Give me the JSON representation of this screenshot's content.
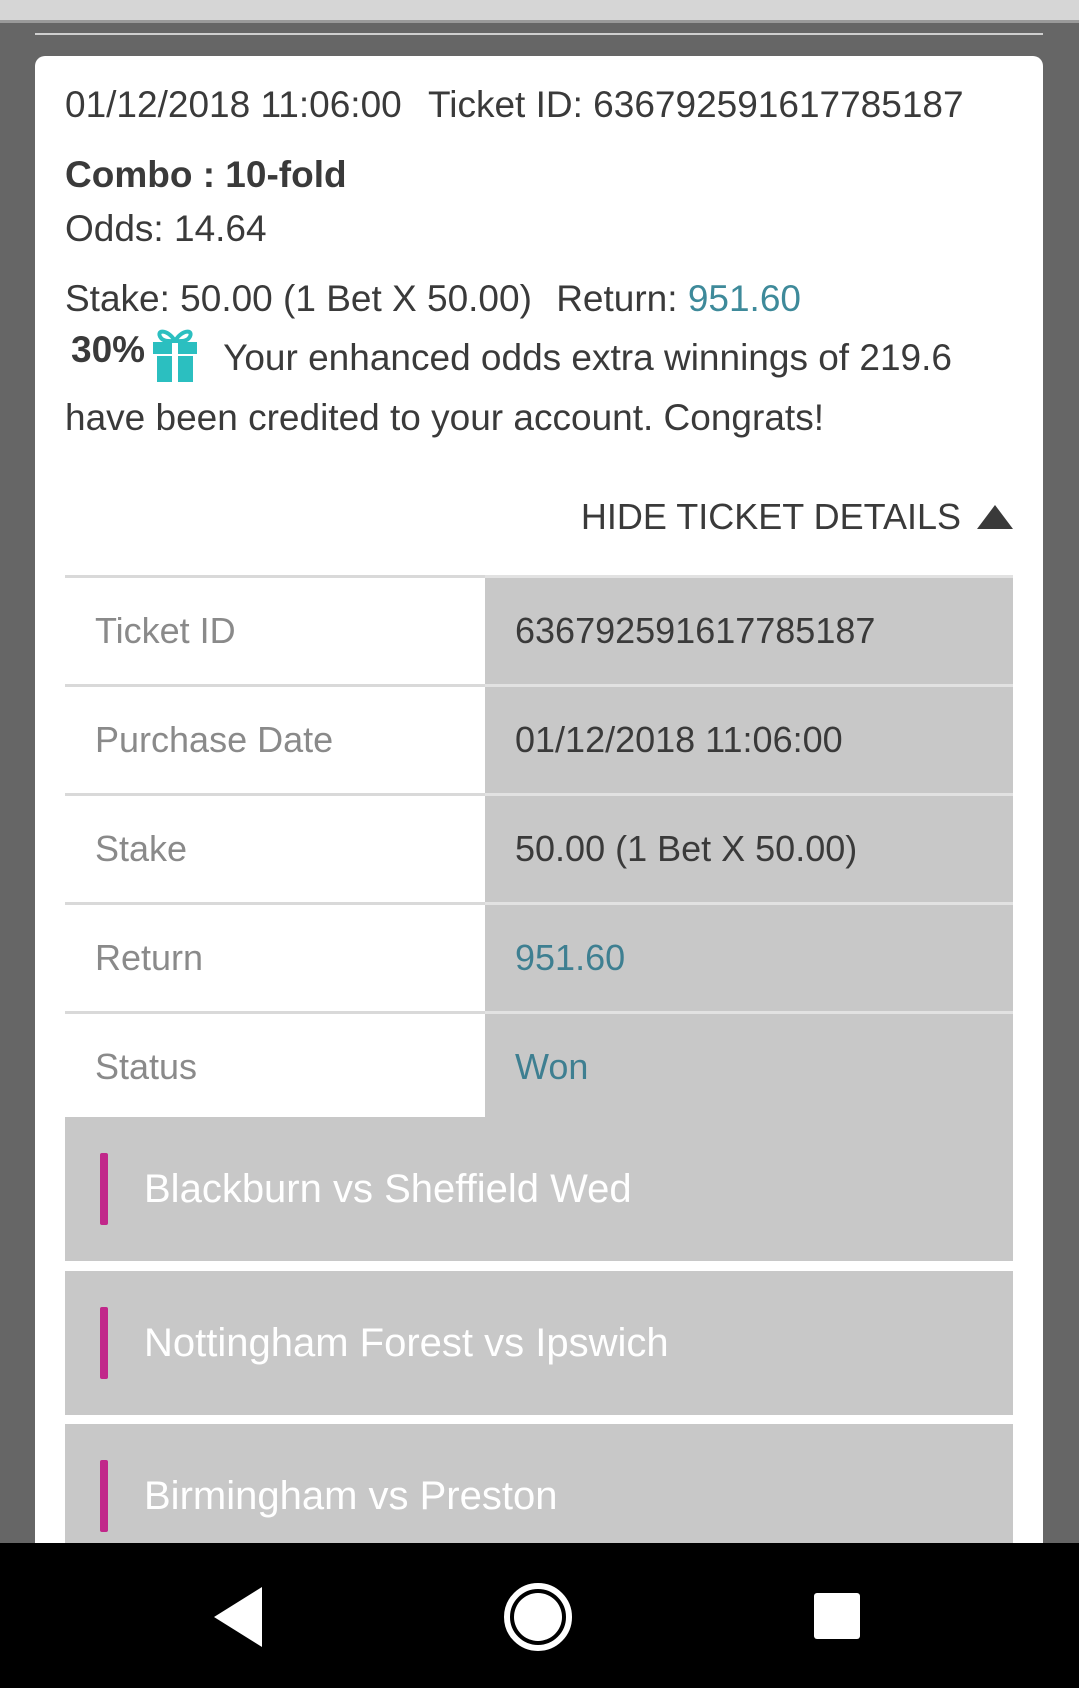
{
  "ticket": {
    "date": "01/12/2018 11:06:00",
    "ticket_id_text": "Ticket ID: 636792591617785187",
    "combo": "Combo : 10-fold",
    "odds": "Odds: 14.64",
    "stake_text": "Stake: 50.00 (1 Bet X 50.00)",
    "return_label": "Return:",
    "return_value": "951.60",
    "return_color": "#3e8a9a"
  },
  "promo": {
    "percent": "30%",
    "icon": "gift-icon",
    "icon_color": "#2bbfc0",
    "message": "Your enhanced odds extra winnings of 219.6 have been credited to your account. Congrats!"
  },
  "toggle": {
    "label": "HIDE TICKET DETAILS",
    "icon": "triangle-up-icon"
  },
  "details": [
    {
      "key": "Ticket ID",
      "value": "636792591617785187"
    },
    {
      "key": "Purchase Date",
      "value": "01/12/2018 11:06:00"
    },
    {
      "key": "Stake",
      "value": "50.00 (1 Bet X 50.00)"
    },
    {
      "key": "Return",
      "value": "951.60"
    },
    {
      "key": "Status",
      "value": "Won"
    }
  ],
  "matches": [
    {
      "label": "Blackburn vs Sheffield Wed"
    },
    {
      "label": "Nottingham Forest vs Ipswich"
    },
    {
      "label": "Birmingham vs Preston"
    }
  ],
  "accent_color": "#c1278a",
  "navbar": {
    "icons": [
      "back-icon",
      "home-icon",
      "recents-icon"
    ]
  }
}
